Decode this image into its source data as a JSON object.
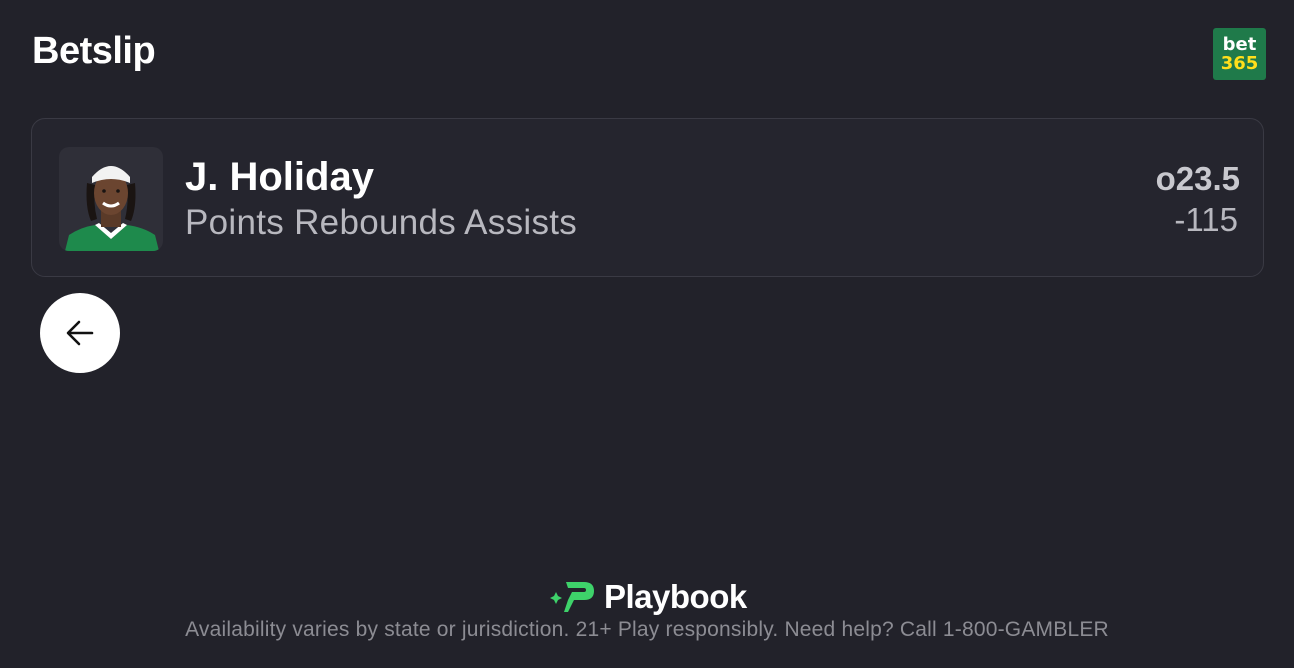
{
  "header": {
    "title": "Betslip",
    "sportsbook_logo": {
      "line1": "bet",
      "line2": "365",
      "bg_color": "#1f7a4a",
      "accent_color": "#ffdf1b"
    }
  },
  "bet": {
    "player_name": "J. Holiday",
    "market": "Points Rebounds Assists",
    "line": "o23.5",
    "odds": "-115",
    "avatar_icon": "player-headshot"
  },
  "nav": {
    "back_icon": "arrow-left-icon"
  },
  "footer": {
    "brand": "Playbook",
    "brand_color": "#3ed26a",
    "disclaimer": "Availability varies by state or jurisdiction. 21+ Play responsibly. Need help? Call 1-800-GAMBLER"
  }
}
